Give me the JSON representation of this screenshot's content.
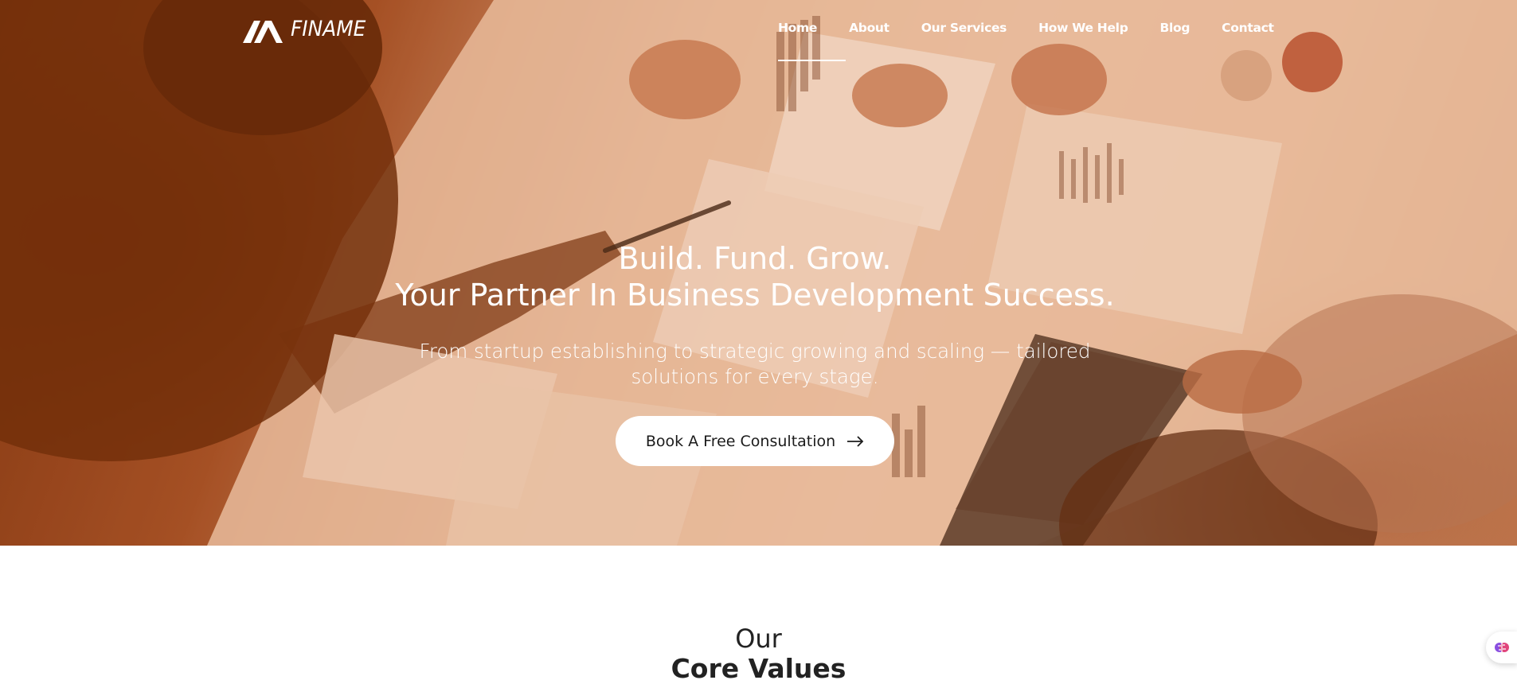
{
  "brand": {
    "name": "FINAME",
    "logo_icon": "finame-logo-mark"
  },
  "nav": {
    "items": [
      {
        "label": "Home",
        "active": true
      },
      {
        "label": "About"
      },
      {
        "label": "Our Services"
      },
      {
        "label": "How We Help"
      },
      {
        "label": "Blog"
      },
      {
        "label": "Contact"
      }
    ]
  },
  "hero": {
    "title_line1": "Build. Fund. Grow.",
    "title_line2": "Your Partner In Business Development Success.",
    "subtitle": "From startup establishing to strategic growing and scaling — tailored solutions for every stage.",
    "cta_label": "Book A Free Consultation",
    "cta_icon": "arrow-right-icon"
  },
  "core_values": {
    "heading_light": "Our",
    "heading_bold": "Core Values"
  },
  "widget": {
    "icon": "brain-icon"
  },
  "colors": {
    "hero_tint": "#c4663a",
    "text_dark": "#222222",
    "white": "#ffffff"
  }
}
